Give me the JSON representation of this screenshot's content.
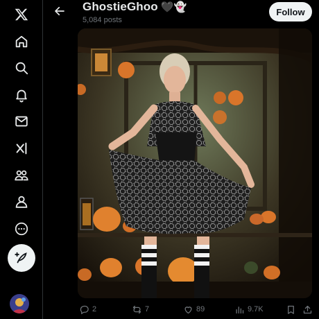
{
  "nav": {
    "items": [
      {
        "icon": "x-logo-icon"
      },
      {
        "icon": "home-icon"
      },
      {
        "icon": "search-icon"
      },
      {
        "icon": "notifications-bell-icon"
      },
      {
        "icon": "messages-envelope-icon"
      },
      {
        "icon": "grok-icon"
      },
      {
        "icon": "communities-icon"
      },
      {
        "icon": "profile-icon"
      },
      {
        "icon": "more-circle-icon"
      }
    ],
    "post_icon": "feather-plus-icon"
  },
  "header": {
    "display_name": "GhostieGhoo",
    "name_emojis": "🖤👻",
    "posts_count": "5,084 posts",
    "follow_label": "Follow"
  },
  "actions": {
    "replies": "2",
    "reposts": "7",
    "likes": "89",
    "views": "9.7K"
  },
  "colors": {
    "background": "#000000",
    "text_primary": "#e7e9ea",
    "text_secondary": "#71767b",
    "follow_bg": "#eff3f4"
  }
}
